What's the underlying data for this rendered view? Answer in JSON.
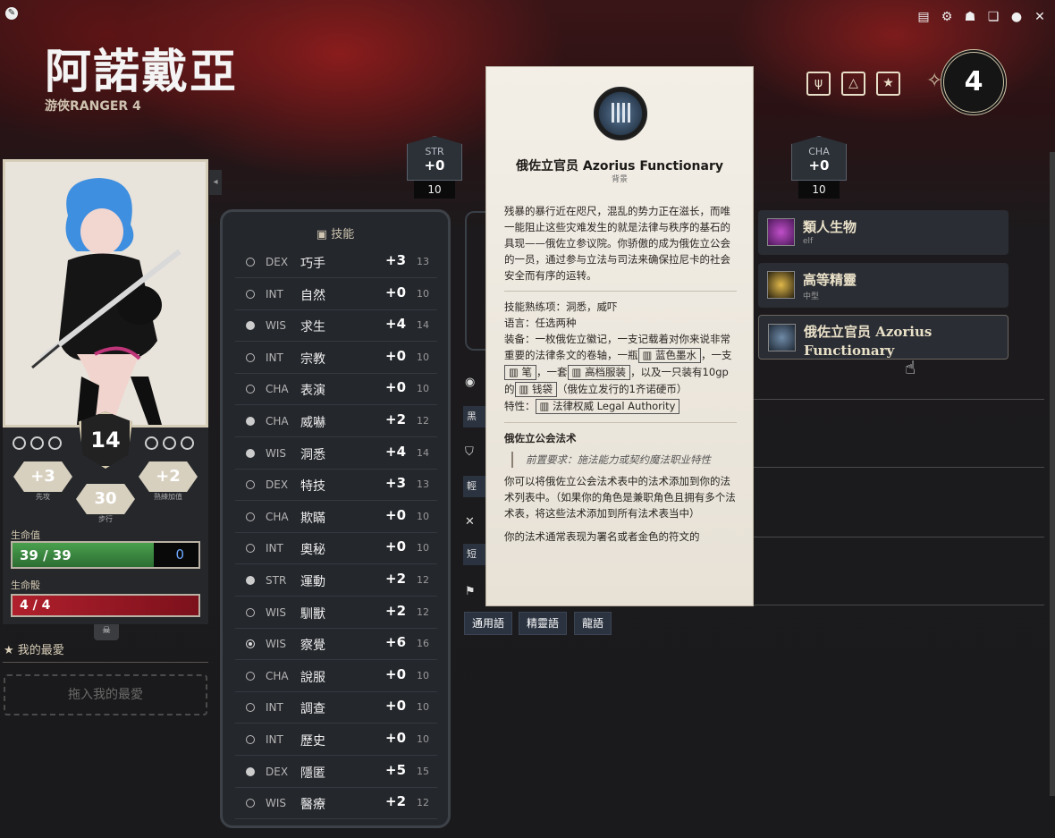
{
  "character": {
    "name": "阿諾戴亞",
    "class_line": "游俠RANGER 4",
    "level": "4"
  },
  "abilities": [
    {
      "label": "STR",
      "modifier": "+0",
      "score": "10"
    },
    {
      "label": "CHA",
      "modifier": "+0",
      "score": "10"
    }
  ],
  "armor_class": "14",
  "stats": {
    "initiative": {
      "value": "+3",
      "label": "先攻"
    },
    "proficiency": {
      "value": "+2",
      "label": "熟練加值"
    },
    "speed": {
      "value": "30",
      "label": "步行"
    }
  },
  "hp": {
    "label": "生命值",
    "current": "39",
    "max": "39",
    "text": "39 / 39",
    "temp": "0",
    "fraction": 1.0
  },
  "hit_dice": {
    "label": "生命骰",
    "text": "4 / 4"
  },
  "favorites": {
    "title": "我的最愛",
    "drop_hint": "拖入我的最愛"
  },
  "skills": {
    "title": "技能",
    "rows": [
      {
        "prof": "none",
        "ability": "DEX",
        "name": "巧手",
        "mod": "+3",
        "passive": "13"
      },
      {
        "prof": "none",
        "ability": "INT",
        "name": "自然",
        "mod": "+0",
        "passive": "10"
      },
      {
        "prof": "proficient",
        "ability": "WIS",
        "name": "求生",
        "mod": "+4",
        "passive": "14"
      },
      {
        "prof": "none",
        "ability": "INT",
        "name": "宗教",
        "mod": "+0",
        "passive": "10"
      },
      {
        "prof": "none",
        "ability": "CHA",
        "name": "表演",
        "mod": "+0",
        "passive": "10"
      },
      {
        "prof": "proficient",
        "ability": "CHA",
        "name": "威嚇",
        "mod": "+2",
        "passive": "12"
      },
      {
        "prof": "proficient",
        "ability": "WIS",
        "name": "洞悉",
        "mod": "+4",
        "passive": "14"
      },
      {
        "prof": "none",
        "ability": "DEX",
        "name": "特技",
        "mod": "+3",
        "passive": "13"
      },
      {
        "prof": "none",
        "ability": "CHA",
        "name": "欺瞞",
        "mod": "+0",
        "passive": "10"
      },
      {
        "prof": "none",
        "ability": "INT",
        "name": "奧秘",
        "mod": "+0",
        "passive": "10"
      },
      {
        "prof": "proficient",
        "ability": "STR",
        "name": "運動",
        "mod": "+2",
        "passive": "12"
      },
      {
        "prof": "none",
        "ability": "WIS",
        "name": "馴獸",
        "mod": "+2",
        "passive": "12"
      },
      {
        "prof": "expertise",
        "ability": "WIS",
        "name": "察覺",
        "mod": "+6",
        "passive": "16"
      },
      {
        "prof": "none",
        "ability": "CHA",
        "name": "說服",
        "mod": "+0",
        "passive": "10"
      },
      {
        "prof": "none",
        "ability": "INT",
        "name": "調查",
        "mod": "+0",
        "passive": "10"
      },
      {
        "prof": "none",
        "ability": "INT",
        "name": "歷史",
        "mod": "+0",
        "passive": "10"
      },
      {
        "prof": "proficient",
        "ability": "DEX",
        "name": "隱匿",
        "mod": "+5",
        "passive": "15"
      },
      {
        "prof": "none",
        "ability": "WIS",
        "name": "醫療",
        "mod": "+2",
        "passive": "12"
      }
    ]
  },
  "features": [
    {
      "title": "類人生物",
      "sub": "elf",
      "icon": "humanoid-icon"
    },
    {
      "title": "高等精靈",
      "sub": "中型",
      "icon": "high-elf-icon"
    },
    {
      "title": "俄佐立官员 Azorius Functionary",
      "sub": "",
      "icon": "background-icon"
    }
  ],
  "languages": [
    "通用語",
    "精靈語",
    "龍語"
  ],
  "tooltip": {
    "title": "俄佐立官员 Azorius Functionary",
    "subtitle": "背景",
    "description": "残暴的暴行近在咫尺，混乱的势力正在滋长，而唯一能阻止这些灾难发生的就是法律与秩序的基石的具现——俄佐立参议院。你骄傲的成为俄佐立公会的一员，通过参与立法与司法来确保拉尼卡的社会安全而有序的运转。",
    "skills_line": "技能熟练项：洞悉，威吓",
    "languages_line": "语言：任选两种",
    "equip_prefix": "装备：一枚俄佐立徽记，一支记载着对你来说非常重要的法律条文的卷轴，一瓶",
    "equip_ink": "蓝色墨水",
    "equip_mid1": "，一支",
    "equip_pen": "笔",
    "equip_mid2": "，一套",
    "equip_clothes": "高档服装",
    "equip_mid3": "，以及一只装有10gp的",
    "equip_pouch": "钱袋",
    "equip_suffix": "（俄佐立发行的1齐诺硬币）",
    "feature_prefix": "特性：",
    "feature_tag": "法律权威 Legal Authority",
    "magic_title": "俄佐立公会法术",
    "magic_req": "前置要求：施法能力或契约魔法职业特性",
    "magic_body": "你可以将俄佐立公会法术表中的法术添加到你的法术列表中。（如果你的角色是兼职角色且拥有多个法术表，将这些法术添加到所有法术表当中）",
    "magic_more": "你的法术通常表现为署名或者金色的符文的"
  },
  "colors": {
    "accent": "#d8d0bf",
    "hp": "#3b8a41",
    "hit_dice": "#a11a27",
    "temp_hp": "#6ea8ff"
  }
}
